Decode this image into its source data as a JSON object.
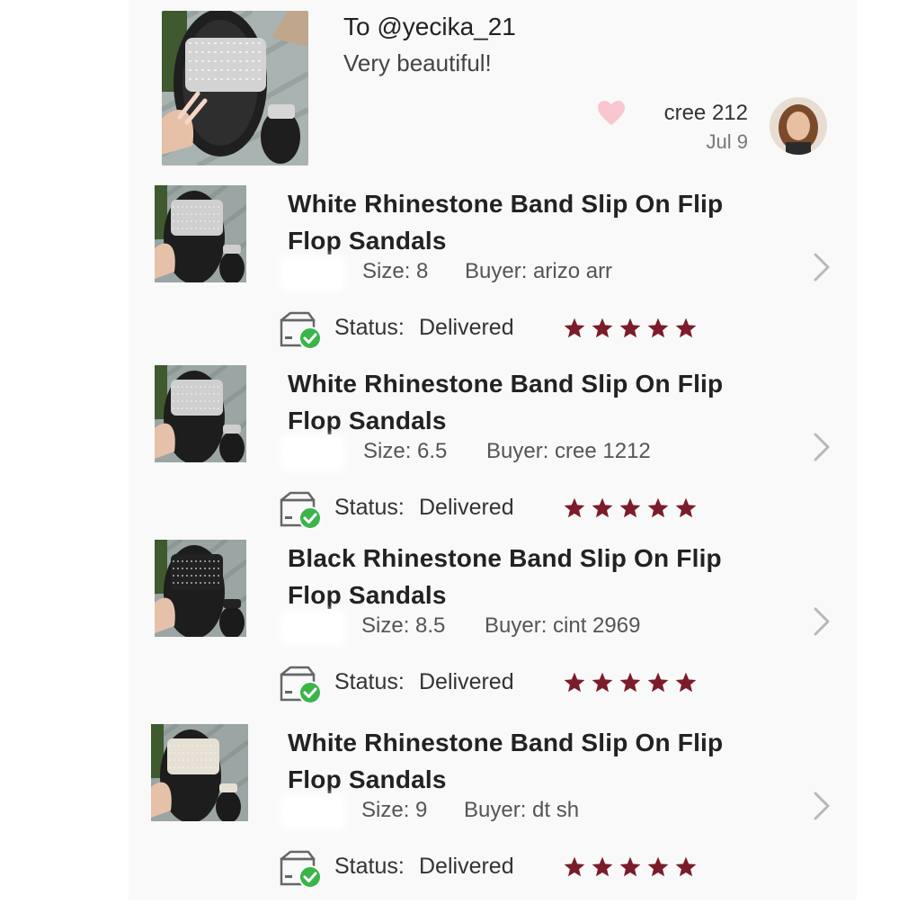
{
  "review": {
    "to": "To @yecika_21",
    "text": "Very beautiful!",
    "reviewer": "cree  212",
    "date": "Jul 9"
  },
  "orders": [
    {
      "title_line1": "White Rhinestone Band Slip On Flip",
      "title_line2": "Flop Sandals",
      "size": "Size: 8",
      "buyer": "Buyer: arizo     arr",
      "status_label": "Status:",
      "status_value": "Delivered",
      "rating": 5,
      "band_color": "#cfcfcf"
    },
    {
      "title_line1": "White Rhinestone Band Slip On Flip",
      "title_line2": "Flop Sandals",
      "size": "Size: 6.5",
      "buyer": "Buyer: cree   1212",
      "status_label": "Status:",
      "status_value": "Delivered",
      "rating": 5,
      "band_color": "#cfcfcf"
    },
    {
      "title_line1": "Black Rhinestone Band Slip On Flip",
      "title_line2": "Flop Sandals",
      "size": "Size: 8.5",
      "buyer": "Buyer: cint    2969",
      "status_label": "Status:",
      "status_value": "Delivered",
      "rating": 5,
      "band_color": "#222222"
    },
    {
      "title_line1": "White Rhinestone Band Slip On Flip",
      "title_line2": "Flop Sandals",
      "size": "Size: 9",
      "buyer": "Buyer: dt    sh",
      "status_label": "Status:",
      "status_value": "Delivered",
      "rating": 5,
      "band_color": "#e6e0d4"
    }
  ],
  "colors": {
    "star": "#7b1c2a",
    "heart": "#f7c6cf",
    "check": "#3bb54a",
    "chevron": "#b8b8b8"
  },
  "icons": {
    "heart": "heart-icon",
    "package": "package-delivered-icon",
    "chevron": "chevron-right-icon",
    "star": "star-icon"
  }
}
